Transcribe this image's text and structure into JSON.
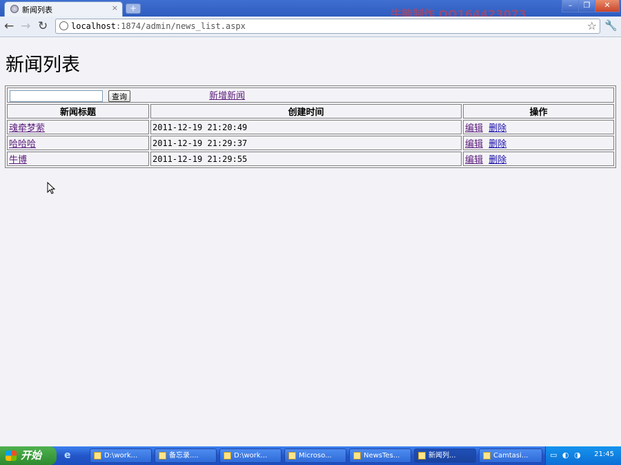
{
  "browser": {
    "tab_title": "新闻列表",
    "tab_close": "×",
    "new_tab": "+",
    "url_host": "localhost",
    "url_rest": ":1874/admin/news_list.aspx",
    "watermark": "牛腩制作 QQ164423073",
    "window_controls": {
      "minimize": "–",
      "maximize": "❐",
      "close": "✕"
    }
  },
  "icons": {
    "back": "←",
    "forward": "→",
    "reload": "↻",
    "star": "☆",
    "wrench": "🔧"
  },
  "page": {
    "title": "新闻列表",
    "search": {
      "value": "",
      "button_label": "查询"
    },
    "add_link": "新增新闻",
    "columns": [
      "新闻标题",
      "创建时间",
      "操作"
    ],
    "rows": [
      {
        "title": "魂牵梦萦",
        "created": "2011-12-19 21:20:49",
        "edit": "编辑",
        "delete": "删除"
      },
      {
        "title": "哈哈哈",
        "created": "2011-12-19 21:29:37",
        "edit": "编辑",
        "delete": "删除"
      },
      {
        "title": "牛博",
        "created": "2011-12-19 21:29:55",
        "edit": "编辑",
        "delete": "删除"
      }
    ]
  },
  "taskbar": {
    "start_label": "开始",
    "tasks": [
      {
        "label": "D:\\work..."
      },
      {
        "label": "备忘录...."
      },
      {
        "label": "D:\\work..."
      },
      {
        "label": "Microso..."
      },
      {
        "label": "NewsTes..."
      },
      {
        "label": "新闻列..."
      },
      {
        "label": "Camtasi..."
      }
    ],
    "clock": "21:45"
  }
}
